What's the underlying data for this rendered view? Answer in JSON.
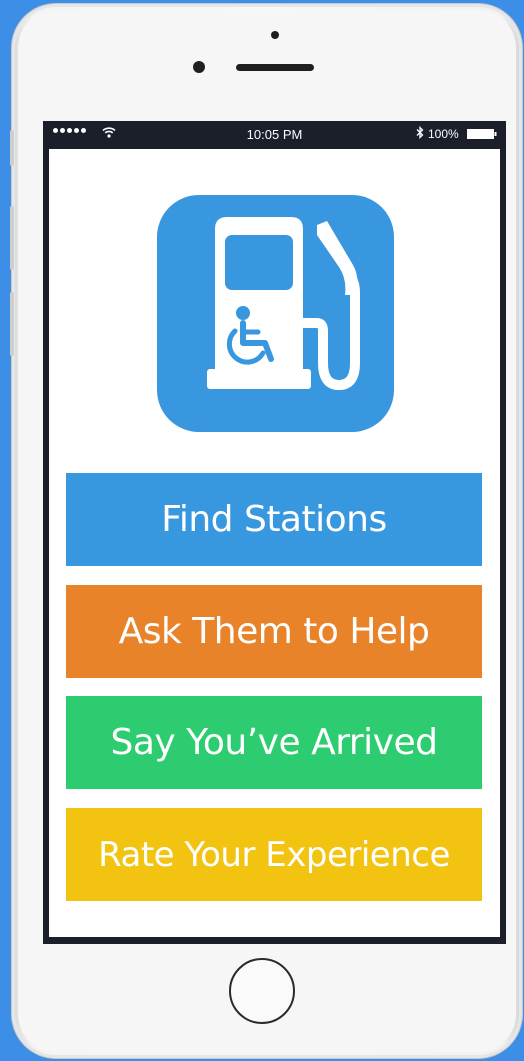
{
  "status_bar": {
    "time": "10:05 PM",
    "battery": "100%",
    "signal_dots": 5,
    "wifi_icon": "wifi-icon",
    "bluetooth_icon": "bluetooth-icon",
    "battery_icon": "battery-icon"
  },
  "app": {
    "icon": "accessible-fuel-pump-icon",
    "icon_color": "#3897df"
  },
  "buttons": [
    {
      "label": "Find Stations",
      "color": "#3898df"
    },
    {
      "label": "Ask Them to Help",
      "color": "#e8832a"
    },
    {
      "label": "Say You’ve Arrived",
      "color": "#2ecc71"
    },
    {
      "label": "Rate Your Experience",
      "color": "#f2c311"
    }
  ],
  "colors": {
    "background": "#3d8ee6",
    "screen_bezel": "#1b1f2a"
  }
}
